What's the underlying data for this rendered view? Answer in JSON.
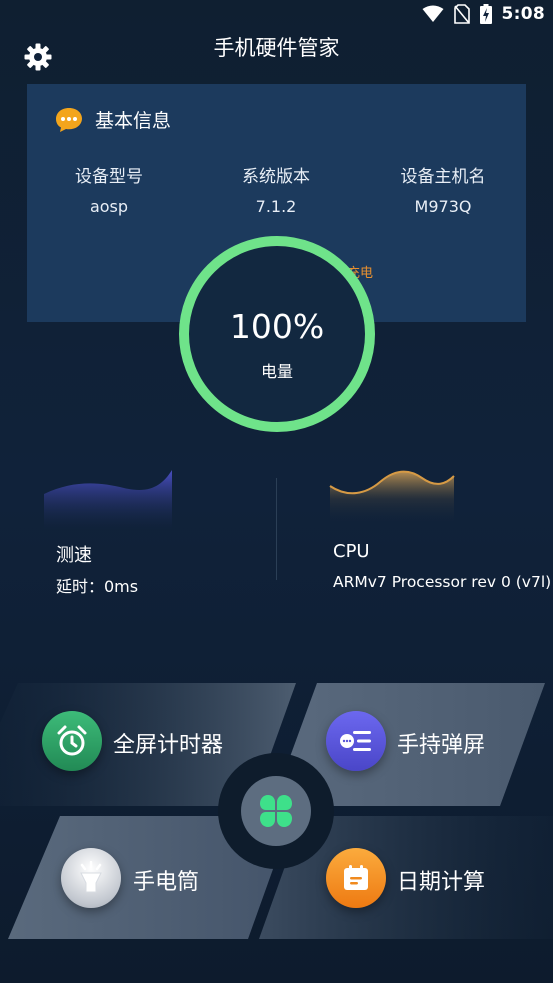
{
  "status_bar": {
    "time": "5:08",
    "icons": [
      "wifi-icon",
      "no-sim-icon",
      "battery-charging-icon"
    ]
  },
  "app": {
    "title": "手机硬件管家"
  },
  "info_card": {
    "title": "基本信息",
    "columns": [
      {
        "label": "设备型号",
        "value": "aosp"
      },
      {
        "label": "系统版本",
        "value": "7.1.2"
      },
      {
        "label": "设备主机名",
        "value": "M973Q"
      }
    ],
    "charging_label": "充电"
  },
  "battery": {
    "percent_text": "100%",
    "label": "电量",
    "level": 1.0,
    "ring_color": "#6fe38a"
  },
  "speed": {
    "title": "测速",
    "latency": "延时：0ms"
  },
  "cpu": {
    "title": "CPU",
    "processor": "ARMv7 Processor rev 0 (v7l)"
  },
  "tools": [
    {
      "label": "全屏计时器",
      "icon": "alarm-clock-icon",
      "color": "#2fa36a"
    },
    {
      "label": "手持弹屏",
      "icon": "chat-lines-icon",
      "color": "#5b57d9"
    },
    {
      "label": "手电筒",
      "icon": "flashlight-icon",
      "color": "#c9cdd3"
    },
    {
      "label": "日期计算",
      "icon": "calendar-icon",
      "color": "#f08a1e"
    }
  ],
  "center_icon": "clover-icon",
  "colors": {
    "background": "#10223a",
    "card": "#1c3a5d",
    "accent_green": "#6fe38a",
    "accent_orange": "#e8902f"
  }
}
